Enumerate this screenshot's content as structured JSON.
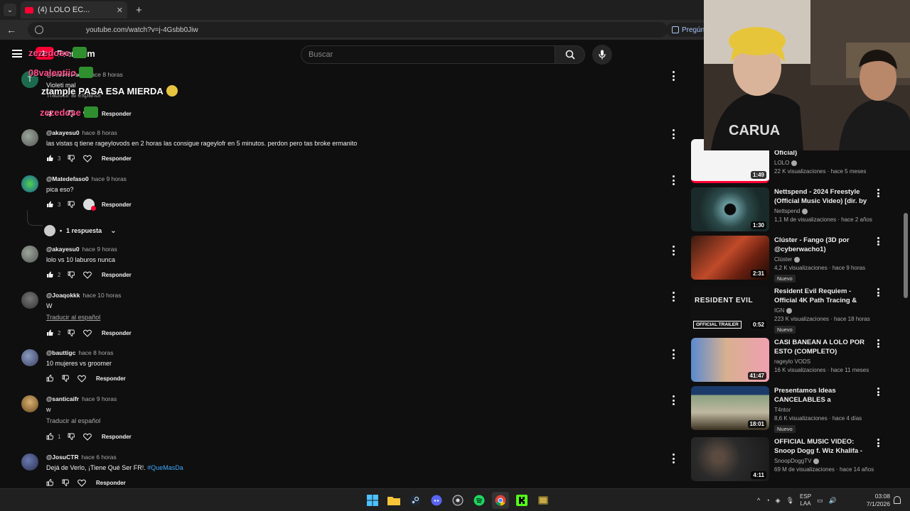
{
  "browser": {
    "tab_title": "(4) LOLO EC...",
    "url": "youtube.com/watch?v=j-4Gsbb0Jiw",
    "ask_button": "Pregúnta"
  },
  "header": {
    "logo_text": "Premium",
    "search_placeholder": "Buscar"
  },
  "chat_overlay": [
    {
      "user": "zezedose",
      "message": ""
    },
    {
      "user": "08valentiio",
      "message": ""
    },
    {
      "user": "ztample",
      "message": "PASA ESA MIERDA"
    },
    {
      "user": "zezedose",
      "message": ""
    }
  ],
  "comments": [
    {
      "handle": "@MatiasFacu",
      "time": "hace 8 horas",
      "text": "Violeti mal",
      "translate": "Traducir al español",
      "likes": "",
      "reply": "Responder"
    },
    {
      "handle": "@akayesu0",
      "time": "hace 8 horas",
      "text": "las vistas q tiene rageylovods en 2 horas las consigue rageylofr en 5 minutos. perdon pero tas broke ermanito",
      "translate": "",
      "likes": "3",
      "reply": "Responder"
    },
    {
      "handle": "@Matedefaso0",
      "time": "hace 9 horas",
      "text": "pica eso?",
      "translate": "",
      "likes": "3",
      "reply": "Responder"
    },
    {
      "handle": "@akayesu0",
      "time": "hace 9 horas",
      "text": "lolo vs 10 laburos nunca",
      "translate": "",
      "likes": "2",
      "reply": "Responder"
    },
    {
      "handle": "@Joaqokkk",
      "time": "hace 10 horas",
      "text": "W",
      "translate": "Traducir al español",
      "likes": "2",
      "reply": "Responder"
    },
    {
      "handle": "@bauttigc",
      "time": "hace 8 horas",
      "text": "10 mujeres vs groomer",
      "translate": "",
      "likes": "",
      "reply": "Responder"
    },
    {
      "handle": "@santicaifr",
      "time": "hace 9 horas",
      "text": "w",
      "translate": "Traducir al español",
      "likes": "1",
      "reply": "Responder"
    },
    {
      "handle": "@JosuCTR",
      "time": "hace 6 horas",
      "text": "Dejá de Verlo, ¡Tiene Qué Ser FR!.",
      "hashtag": "#QueMasDa",
      "translate": "",
      "likes": "",
      "reply": "Responder"
    }
  ],
  "replies_toggle": "1 respuesta",
  "recommendations": [
    {
      "title": "Oficial)",
      "channel": "LOLO",
      "stats": "22 K visualizaciones · hace 5 meses",
      "duration": "1:49",
      "badge": "",
      "thumb_color": "#f4f4f4"
    },
    {
      "title": "Nettspend - 2024 Freestyle (Official Music Video) [dir. by ...",
      "channel": "Nettspend",
      "stats": "1,1 M de visualizaciones · hace 2 años",
      "duration": "1:30",
      "badge": "",
      "thumb_color": "#2c4a4a"
    },
    {
      "title": "Clúster - Fango (3D por @cyberwacho1)",
      "channel": "Clúster",
      "stats": "4,2 K visualizaciones · hace 9 horas",
      "duration": "2:31",
      "badge": "Nuevo",
      "thumb_color": "#7a2a1a"
    },
    {
      "title": "Resident Evil Requiem - Official 4K Path Tracing & NVIDIA DLS...",
      "channel": "IGN",
      "stats": "223 K visualizaciones · hace 18 horas",
      "duration": "0:52",
      "badge": "Nuevo",
      "thumb_color": "#111111",
      "thumb_text": "RESIDENT EVIL",
      "thumb_label": "OFFICIAL TRAILER"
    },
    {
      "title": "CASI BANEAN A LOLO POR ESTO (COMPLETO)",
      "channel": "rageylo VODS",
      "stats": "16 K visualizaciones · hace 11 meses",
      "duration": "41:47",
      "badge": "",
      "thumb_color": "#5a8ad0"
    },
    {
      "title": "Presentamos Ideas CANCELABLES a Desconocido...",
      "channel": "T4ntor",
      "stats": "8,6 K visualizaciones · hace 4 días",
      "duration": "18:01",
      "badge": "Nuevo",
      "thumb_color": "#8aa080"
    },
    {
      "title": "OFFICIAL MUSIC VIDEO: Snoop Dogg f. Wiz Khalifa - That Good",
      "channel": "SnoopDoggTV",
      "stats": "69 M de visualizaciones · hace 14 años",
      "duration": "4:11",
      "badge": "",
      "thumb_color": "#2a2a2a"
    }
  ],
  "taskbar": {
    "lang_top": "ESP",
    "lang_bottom": "LAA",
    "time": "03:08",
    "date": "7/1/2026"
  },
  "colors": {
    "accent_red": "#ff0033",
    "link_blue": "#3ea6ff",
    "background": "#0f0f0f"
  }
}
